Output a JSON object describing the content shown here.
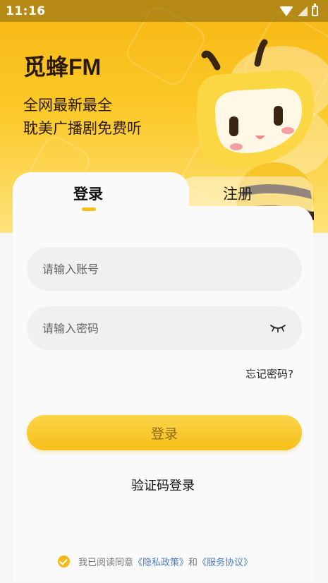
{
  "status_bar": {
    "time": "11:16"
  },
  "app": {
    "title": "觅蜂FM",
    "tagline_line1": "全网最新最全",
    "tagline_line2": "耽美广播剧免费听"
  },
  "tabs": [
    {
      "label": "登录",
      "active": true
    },
    {
      "label": "注册",
      "active": false
    }
  ],
  "form": {
    "account_placeholder": "请输入账号",
    "password_placeholder": "请输入密码",
    "forgot_password": "忘记密码?",
    "login_button": "登录",
    "sms_login": "验证码登录"
  },
  "agreement": {
    "prefix": "我已阅读同意",
    "privacy_link": "《隐私政策》",
    "conjunction": "和",
    "service_link": "《服务协议》",
    "checked": true
  },
  "colors": {
    "brand_yellow": "#f7bf1a",
    "link_blue": "#4e7ec0"
  },
  "icons": [
    "wifi-icon",
    "signal-icon",
    "battery-icon",
    "eye-closed-icon",
    "check-icon",
    "bee-mascot"
  ]
}
